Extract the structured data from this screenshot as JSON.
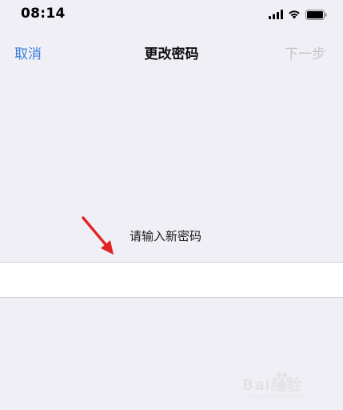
{
  "status_bar": {
    "time": "08:14",
    "icons": [
      "cellular-signal-icon",
      "wifi-icon",
      "battery-icon"
    ]
  },
  "nav": {
    "cancel_label": "取消",
    "title": "更改密码",
    "next_label": "下一步"
  },
  "form": {
    "prompt": "请输入新密码",
    "password_value": ""
  },
  "watermark": {
    "brand": "Bai经验",
    "url": "jingyan.baidu.com"
  },
  "colors": {
    "background": "#f0eff5",
    "accent": "#3b7ede",
    "disabled": "#c4c4c8",
    "annotation_arrow": "#e02424"
  }
}
